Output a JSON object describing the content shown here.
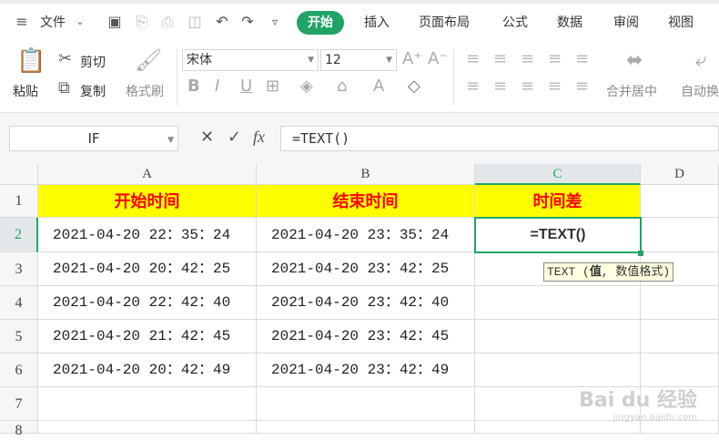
{
  "menubar": {
    "file_label": "文件",
    "tabs": [
      "开始",
      "插入",
      "页面布局",
      "公式",
      "数据",
      "审阅",
      "视图"
    ]
  },
  "ribbon": {
    "paste_label": "粘贴",
    "cut_label": "剪切",
    "copy_label": "复制",
    "format_painter_label": "格式刷",
    "font_name": "宋体",
    "font_size": "12",
    "merge_center_label": "合并居中",
    "auto_wrap_label": "自动换"
  },
  "formula_bar": {
    "name_box": "IF",
    "fx_label": "fx",
    "formula": "=TEXT()"
  },
  "sheet": {
    "columns": [
      "A",
      "B",
      "C",
      "D"
    ],
    "rows": [
      "1",
      "2",
      "3",
      "4",
      "5",
      "6",
      "7",
      "8"
    ],
    "headers": {
      "a": "开始时间",
      "b": "结束时间",
      "c": "时间差"
    },
    "data": [
      {
        "start": "2021-04-20 22：35：24",
        "end": "2021-04-20 23：35：24"
      },
      {
        "start": "2021-04-20 20：42：25",
        "end": "2021-04-20 23：42：25"
      },
      {
        "start": "2021-04-20 22：42：40",
        "end": "2021-04-20 23：42：40"
      },
      {
        "start": "2021-04-20 21：42：45",
        "end": "2021-04-20 23：42：45"
      },
      {
        "start": "2021-04-20 20：42：49",
        "end": "2021-04-20 23：42：49"
      }
    ],
    "active_cell_text": "=TEXT()",
    "tooltip_prefix": "TEXT (",
    "tooltip_bold": "值",
    "tooltip_suffix": ", 数值格式)",
    "accent_color": "#21a366"
  },
  "watermark": {
    "brand": "Bai du 经验",
    "url": "jingyan.baidu.com"
  }
}
